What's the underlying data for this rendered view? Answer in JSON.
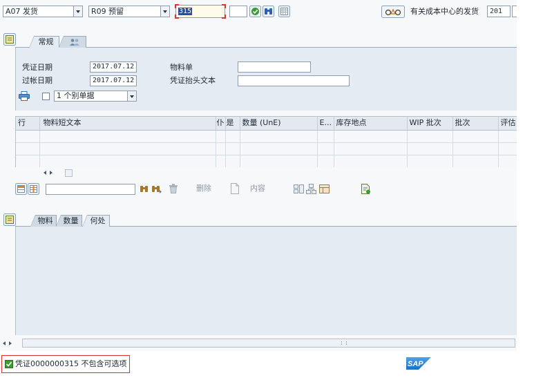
{
  "top_bar": {
    "action": {
      "value": "A07 发货"
    },
    "reference": {
      "value": "R09 预留"
    },
    "movement_type": {
      "value": "315"
    },
    "extra": {
      "value": ""
    },
    "icons": [
      "execute-check-icon",
      "binoculars-icon",
      "grid-icon",
      "display-glasses-icon"
    ],
    "cost_center": {
      "label": "有关成本中心的发货",
      "value": "201"
    }
  },
  "header_tabs": [
    {
      "label": "常规",
      "active": true
    },
    {
      "icon": "partner-icon",
      "active": false
    }
  ],
  "header": {
    "doc_date": {
      "label": "凭证日期",
      "value": "2017.07.12"
    },
    "posting_date": {
      "label": "过帐日期",
      "value": "2017.07.12"
    },
    "material_slip": {
      "label": "物料单",
      "value": ""
    },
    "header_text": {
      "label": "凭证抬头文本",
      "value": ""
    },
    "print": {
      "icon": "printer-icon",
      "checked": false,
      "option": "1 个别单据"
    }
  },
  "items_table": {
    "columns": [
      "行",
      "物料短文本",
      "仆",
      "是",
      "数量 (UnE)",
      "E...",
      "库存地点",
      "WIP 批次",
      "批次",
      "评估"
    ],
    "rows": [
      [
        "",
        "",
        "",
        "",
        "",
        "",
        "",
        "",
        "",
        ""
      ],
      [
        "",
        "",
        "",
        "",
        "",
        "",
        "",
        "",
        "",
        ""
      ],
      [
        "",
        "",
        "",
        "",
        "",
        "",
        "",
        "",
        "",
        ""
      ]
    ]
  },
  "item_toolbar": {
    "search_value": "",
    "delete_label": "删除",
    "content_label": "内容"
  },
  "detail_tabs": [
    {
      "label": "物料",
      "active": false
    },
    {
      "label": "数量",
      "active": false
    },
    {
      "label": "何处",
      "active": true
    }
  ],
  "status_bar": {
    "icon": "success-check-icon",
    "message": "凭证0000000315 不包含可选项"
  },
  "logo": {
    "text": "SAP"
  },
  "colors": {
    "panel": "#e4ebf2",
    "selection": "#27509c",
    "focus": "#d8322f",
    "status_ok": "#3d9a35",
    "logo": "#1a6fc4"
  }
}
